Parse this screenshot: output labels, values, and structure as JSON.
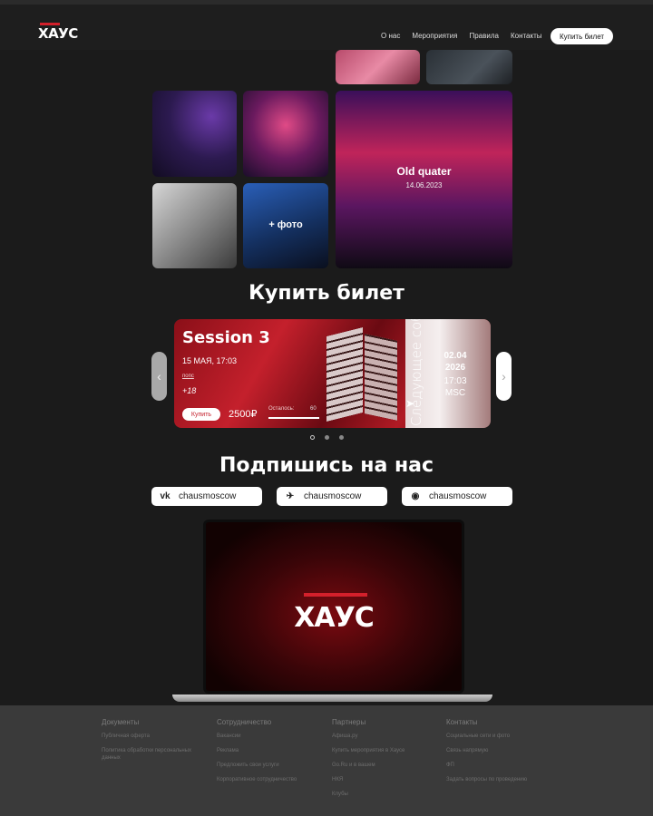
{
  "header": {
    "logo": "ХАУС",
    "nav": [
      "О нас",
      "Мероприятия",
      "Правила",
      "Контакты"
    ],
    "buy_button": "Купить билет"
  },
  "gallery": {
    "featured_title": "Old quater",
    "featured_date": "14.06.2023",
    "more_photos": "+ фото"
  },
  "tickets": {
    "heading": "Купить билет",
    "event": {
      "title": "Session 3",
      "date": "15 МАЯ, 17:03",
      "genre": "попс",
      "age": "+18",
      "buy_label": "Купить",
      "price": "2500₽",
      "remaining_label": "Осталось:",
      "remaining_value": "60",
      "remaining_fraction": 1.0
    },
    "next_event": {
      "label": "Следующее событие",
      "date_line1": "02.04",
      "date_line2": "2026",
      "time": "17:03",
      "timezone": "MSC"
    },
    "arrow_prev": "‹",
    "arrow_next": "›"
  },
  "subscribe": {
    "heading": "Подпишись на нас",
    "links": [
      {
        "icon": "vk-icon",
        "glyph": "vk",
        "handle": "chausmoscow"
      },
      {
        "icon": "telegram-icon",
        "glyph": "✈",
        "handle": "chausmoscow"
      },
      {
        "icon": "discord-icon",
        "glyph": "◉",
        "handle": "chausmoscow"
      }
    ]
  },
  "promo": {
    "logo": "ХАУС"
  },
  "footer": {
    "columns": [
      {
        "title": "Документы",
        "links": [
          "Публичная оферта",
          "Политика обработки персональных данных"
        ]
      },
      {
        "title": "Сотрудничество",
        "links": [
          "Вакансии",
          "Реклама",
          "Предложить свои услуги",
          "Корпоративное сотрудничество"
        ]
      },
      {
        "title": "Партнеры",
        "links": [
          "Афиша.ру",
          "Купить мероприятия в Хаусе",
          "Go.Ru и в вашем",
          "НКЯ",
          "Клубы"
        ]
      },
      {
        "title": "Контакты",
        "links": [
          "Социальные сети и фото",
          "Связь напрямую",
          "ФП",
          "Задать вопросы по проведению"
        ]
      }
    ]
  },
  "colors": {
    "accent": "#d3202b",
    "background": "#1b1b1b"
  }
}
